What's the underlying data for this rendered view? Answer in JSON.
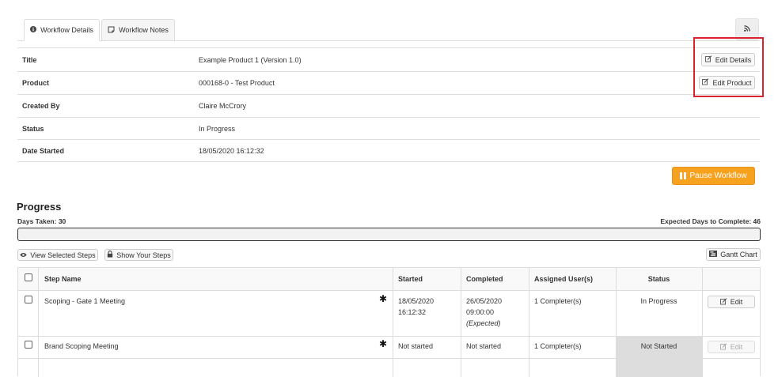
{
  "tabs": [
    {
      "label": "Workflow Details",
      "icon": "info-circle-icon",
      "active": true
    },
    {
      "label": "Workflow Notes",
      "icon": "sticky-note-icon",
      "active": false
    }
  ],
  "rss_icon": "rss-icon",
  "details": {
    "title_label": "Title",
    "title_value": "Example Product 1 (Version 1.0)",
    "product_label": "Product",
    "product_value": "000168-0 - Test Product",
    "created_by_label": "Created By",
    "created_by_value": "Claire McCrory",
    "status_label": "Status",
    "status_value": "In Progress",
    "date_started_label": "Date Started",
    "date_started_value": "18/05/2020 16:12:32",
    "edit_details_label": "Edit Details",
    "edit_product_label": "Edit Product"
  },
  "pause_label": "Pause Workflow",
  "progress": {
    "title": "Progress",
    "days_taken_label": "Days Taken:",
    "days_taken": "30",
    "expected_label": "Expected Days to Complete:",
    "expected": "46",
    "percent_complete": 0
  },
  "toolbar": {
    "view_selected": "View Selected Steps",
    "show_your_steps": "Show Your Steps",
    "gantt_chart": "Gantt Chart"
  },
  "table": {
    "headers": {
      "step_name": "Step Name",
      "started": "Started",
      "completed": "Completed",
      "assigned": "Assigned User(s)",
      "status": "Status"
    },
    "rows": [
      {
        "step_name": "Scoping - Gate 1 Meeting",
        "started_date": "18/05/2020",
        "started_time": "16:12:32",
        "completed_date": "26/05/2020",
        "completed_time": "09:00:00",
        "completed_note": "(Expected)",
        "assigned": "1 Completer(s)",
        "status": "In Progress",
        "edit_label": "Edit"
      },
      {
        "step_name": "Brand Scoping Meeting",
        "started": "Not started",
        "completed": "Not started",
        "assigned": "1 Completer(s)",
        "status": "Not Started",
        "edit_label": "Edit"
      }
    ]
  },
  "colors": {
    "pause_button": "#f6a21e",
    "highlight": "#d9242e",
    "not_started_cell": "#dddddd"
  }
}
